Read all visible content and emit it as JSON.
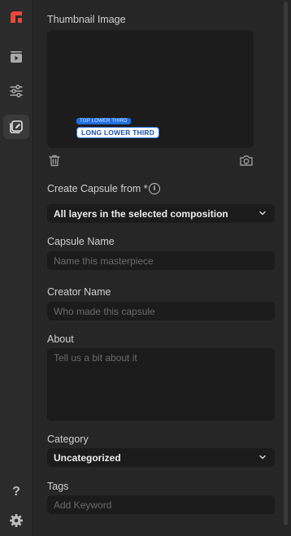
{
  "thumbnail": {
    "label": "Thumbnail Image",
    "preview_top_text": "TOP LOWER THIRD",
    "preview_main_text": "LONG LOWER THIRD"
  },
  "create_from": {
    "label": "Create Capsule from *",
    "info_glyph": "i",
    "selected": "All layers in the selected composition"
  },
  "capsule_name": {
    "label": "Capsule Name",
    "placeholder": "Name this masterpiece"
  },
  "creator_name": {
    "label": "Creator Name",
    "placeholder": "Who made this capsule"
  },
  "about": {
    "label": "About",
    "placeholder": "Tell us a bit about it"
  },
  "category": {
    "label": "Category",
    "selected": "Uncategorized"
  },
  "tags": {
    "label": "Tags",
    "placeholder": "Add Keyword"
  },
  "sidebar": {
    "items": [
      {
        "icon": "logo-icon",
        "active": false
      },
      {
        "icon": "play-queue-icon",
        "active": false
      },
      {
        "icon": "sliders-icon",
        "active": false
      },
      {
        "icon": "capsule-edit-icon",
        "active": true
      }
    ],
    "bottom": [
      {
        "icon": "help-icon",
        "glyph": "?"
      },
      {
        "icon": "gear-icon"
      }
    ]
  },
  "colors": {
    "brand": "#e8483a",
    "preview_blue": "#1f6fe0",
    "background": "#262626",
    "field_bg": "#1b1b1b"
  }
}
